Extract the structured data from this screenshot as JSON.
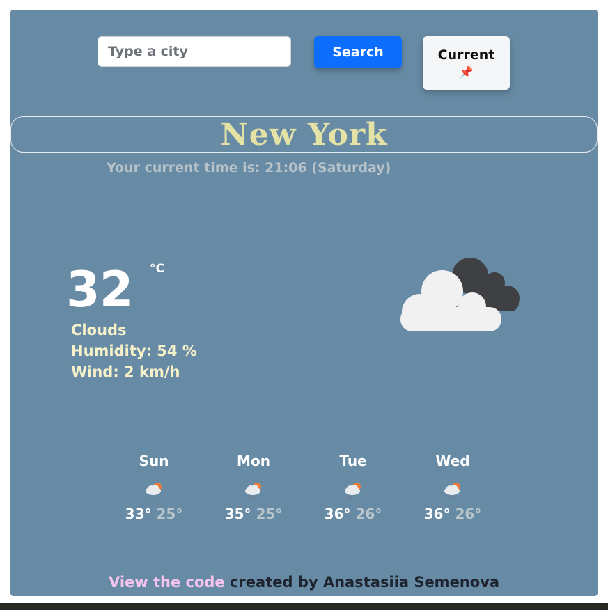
{
  "search": {
    "placeholder": "Type a city",
    "value": "",
    "button_label": "Search",
    "current_label": "Current",
    "current_icon": "pushpin-icon"
  },
  "city": {
    "name": "New York"
  },
  "time": {
    "text": "Your current time is: 21:06 (Saturday)"
  },
  "current": {
    "temperature": "32",
    "unit": "°C",
    "description": "Clouds",
    "humidity": "Humidity: 54 %",
    "wind": "Wind: 2 km/h",
    "icon": "clouds-icon"
  },
  "forecast": [
    {
      "day": "Sun",
      "max": "33°",
      "min": "25°",
      "icon": "rain-sun-icon"
    },
    {
      "day": "Mon",
      "max": "35°",
      "min": "25°",
      "icon": "rain-sun-icon"
    },
    {
      "day": "Tue",
      "max": "36°",
      "min": "26°",
      "icon": "rain-sun-icon"
    },
    {
      "day": "Wed",
      "max": "36°",
      "min": "26°",
      "icon": "rain-sun-icon"
    }
  ],
  "footer": {
    "link_text": "View the code",
    "text": " created by Anastasiia Semenova"
  },
  "colors": {
    "background": "#688ba5",
    "city": "#e4e3a5",
    "details": "#f6f1c8",
    "button": "#0d6efd",
    "link": "#f5c3f0"
  }
}
